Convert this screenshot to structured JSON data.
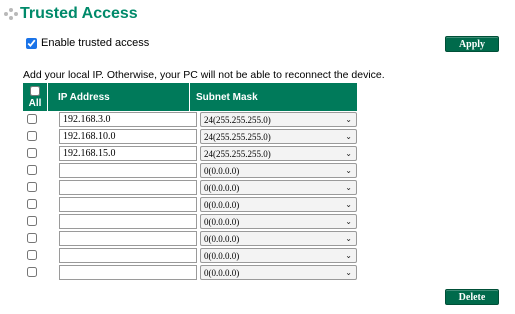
{
  "header": {
    "title": "Trusted Access"
  },
  "enable": {
    "label": "Enable trusted access",
    "checked": true
  },
  "buttons": {
    "apply": "Apply",
    "delete": "Delete"
  },
  "hint": "Add your local IP. Otherwise, your PC will not be able to reconnect the device.",
  "table": {
    "columns": {
      "all": "All",
      "ip": "IP Address",
      "mask": "Subnet Mask"
    },
    "rows": [
      {
        "ip": "192.168.3.0",
        "mask": "24(255.255.255.0)"
      },
      {
        "ip": "192.168.10.0",
        "mask": "24(255.255.255.0)"
      },
      {
        "ip": "192.168.15.0",
        "mask": "24(255.255.255.0)"
      },
      {
        "ip": "",
        "mask": "0(0.0.0.0)"
      },
      {
        "ip": "",
        "mask": "0(0.0.0.0)"
      },
      {
        "ip": "",
        "mask": "0(0.0.0.0)"
      },
      {
        "ip": "",
        "mask": "0(0.0.0.0)"
      },
      {
        "ip": "",
        "mask": "0(0.0.0.0)"
      },
      {
        "ip": "",
        "mask": "0(0.0.0.0)"
      },
      {
        "ip": "",
        "mask": "0(0.0.0.0)"
      }
    ]
  },
  "colors": {
    "accent": "#007a5a",
    "title": "#008a6a",
    "button": "#006a4b"
  }
}
